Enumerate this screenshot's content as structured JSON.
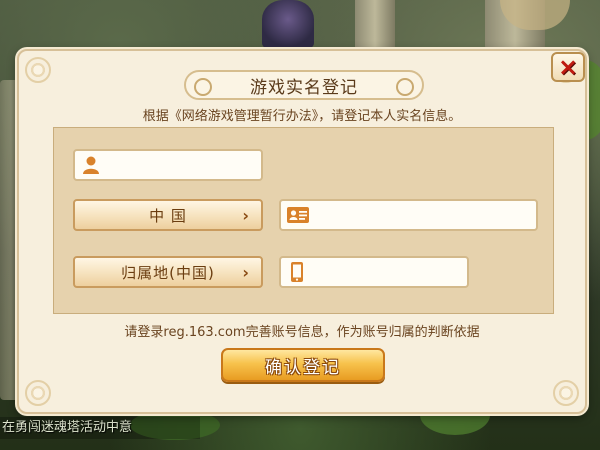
{
  "dialog": {
    "title": "游戏实名登记",
    "subtitle": "根据《网络游戏管理暂行办法》，请登记本人实名信息。",
    "name_field": {
      "value": "",
      "icon": "person-icon"
    },
    "country_select": {
      "label": "中 国",
      "chevron": "›"
    },
    "id_field": {
      "value": "",
      "icon": "id-card-icon"
    },
    "region_select": {
      "label": "归属地(中国)",
      "chevron": "›"
    },
    "phone_field": {
      "value": "",
      "icon": "phone-icon"
    },
    "note": "请登录reg.163.com完善账号信息，作为账号归属的判断依据",
    "confirm_label": "确认登记",
    "close_label": "×"
  },
  "background": {
    "ticker_text": "在勇闯迷魂塔活动中意"
  },
  "colors": {
    "dialog_bg": "#f7efdd",
    "panel_bg": "#e6d2ad",
    "accent_brown": "#6a4420",
    "confirm_gold": "#f7c24c",
    "close_red": "#c01a10",
    "icon_orange": "#d9822b"
  }
}
